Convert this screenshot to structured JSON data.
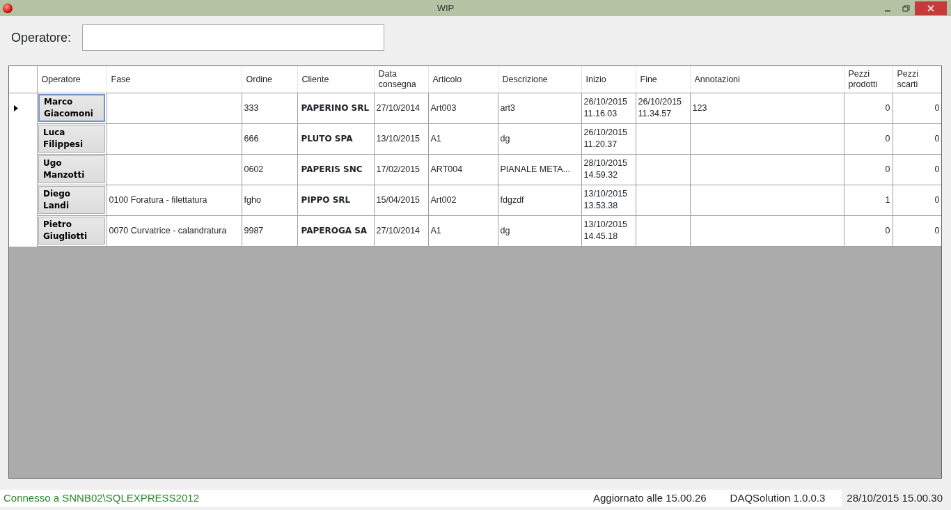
{
  "window": {
    "title": "WIP"
  },
  "filter": {
    "label": "Operatore:"
  },
  "table": {
    "columns": [
      "Operatore",
      "Fase",
      "Ordine",
      "Cliente",
      "Data consegna",
      "Articolo",
      "Descrizione",
      "Inizio",
      "Fine",
      "Annotazioni",
      "Pezzi prodotti",
      "Pezzi scarti"
    ],
    "rows": [
      {
        "selected": true,
        "operatore": "Marco Giacomoni",
        "ordine": "333",
        "cliente": "PAPERINO SRL",
        "data_consegna": "27/10/2014",
        "articolo": "Art003",
        "descrizione": "art3",
        "inizio": "26/10/2015 11.16.03",
        "fine": "26/10/2015 11.34.57",
        "annotazioni": "123",
        "pezzi_prodotti": "0",
        "pezzi_scarti": "0"
      },
      {
        "selected": false,
        "operatore": "Luca Filippesi",
        "ordine": "666",
        "cliente": "PLUTO SPA",
        "data_consegna": "13/10/2015",
        "articolo": "A1",
        "descrizione": "dg",
        "inizio": "26/10/2015 11.20.37",
        "pezzi_prodotti": "0",
        "pezzi_scarti": "0"
      },
      {
        "selected": false,
        "operatore": "Ugo Manzotti",
        "ordine": "0602",
        "cliente": "PAPERIS SNC",
        "data_consegna": "17/02/2015",
        "articolo": "ART004",
        "descrizione": "PIANALE META...",
        "inizio": "28/10/2015 14.59.32",
        "pezzi_prodotti": "0",
        "pezzi_scarti": "0"
      },
      {
        "selected": false,
        "operatore": "Diego Landi",
        "fase": "0100 Foratura - filettatura",
        "ordine": "fgho",
        "cliente": "PIPPO SRL",
        "data_consegna": "15/04/2015",
        "articolo": "Art002",
        "descrizione": "fdgzdf",
        "inizio": "13/10/2015 13.53.38",
        "pezzi_prodotti": "1",
        "pezzi_scarti": "0"
      },
      {
        "selected": false,
        "operatore": "Pietro Giugliotti",
        "fase": "0070 Curvatrice - calandratura",
        "ordine": "9987",
        "cliente": "PAPEROGA SA",
        "data_consegna": "27/10/2014",
        "articolo": "A1",
        "descrizione": "dg",
        "inizio": "13/10/2015 14.45.18",
        "pezzi_prodotti": "0",
        "pezzi_scarti": "0"
      }
    ]
  },
  "status_bar": {
    "connection": "Connesso a SNNB02\\SQLEXPRESS2012",
    "updated": "Aggiornato alle 15.00.26",
    "version": "DAQSolution 1.0.0.3",
    "datetime": "28/10/2015 15.00.30"
  }
}
